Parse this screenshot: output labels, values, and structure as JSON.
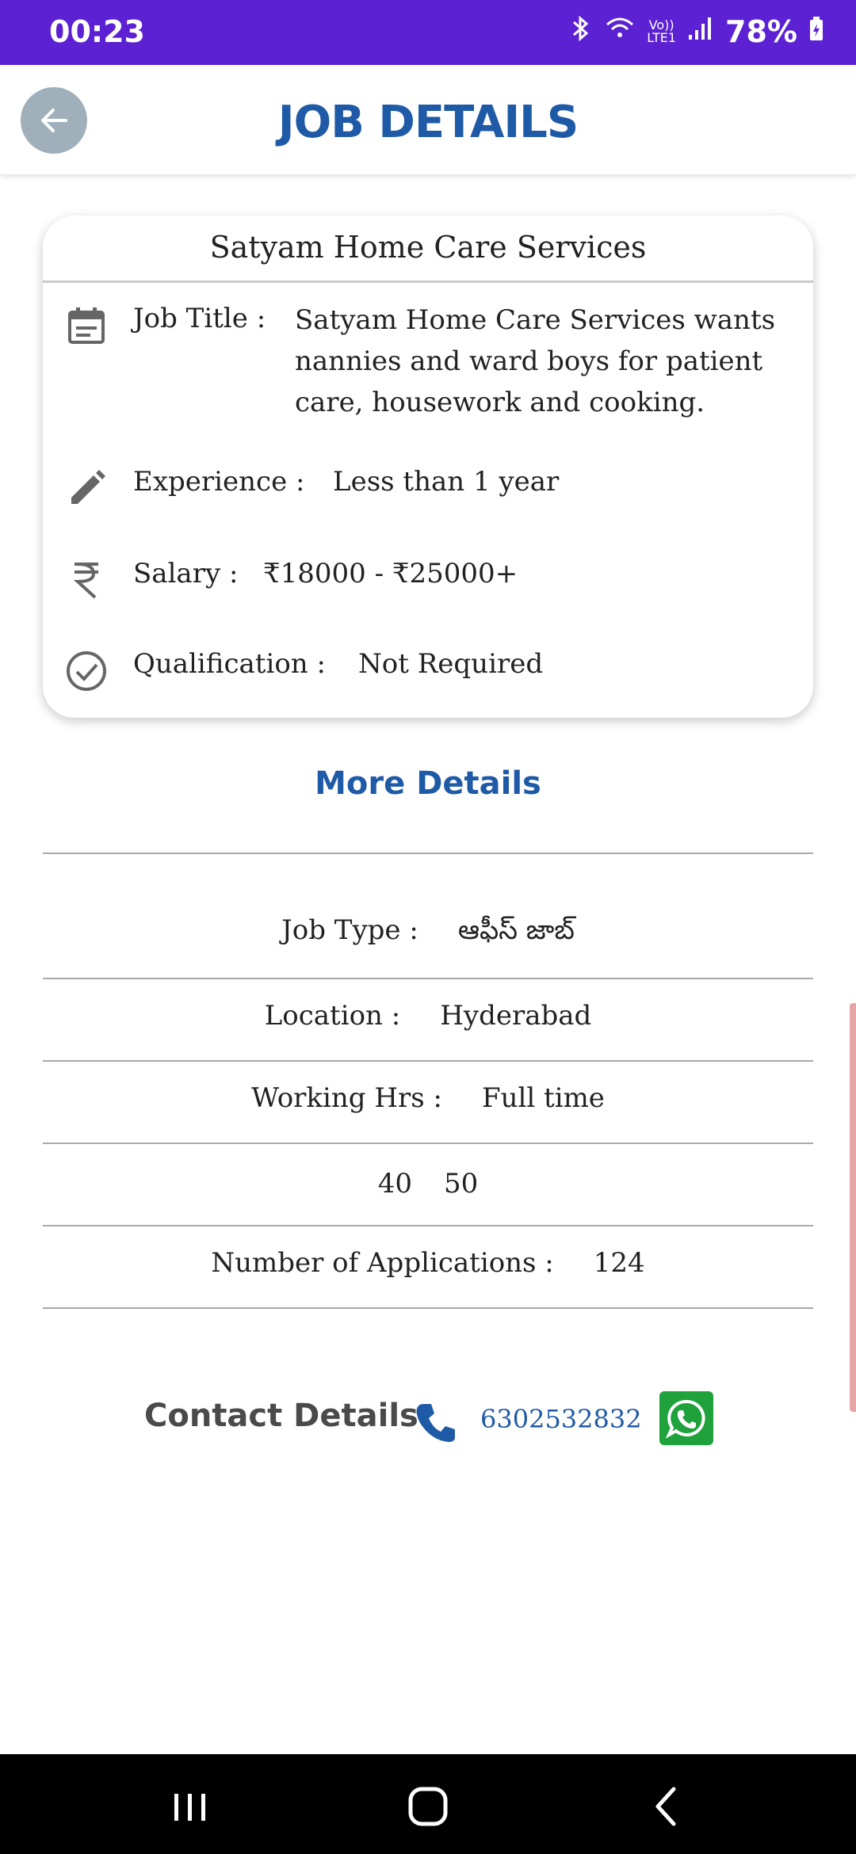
{
  "status_bar": {
    "time": "00:23",
    "network_label_top": "Vo))",
    "network_label_bottom": "LTE1",
    "battery": "78%"
  },
  "app_bar": {
    "title": "JOB DETAILS",
    "back_icon": "arrow-left-icon"
  },
  "job_card": {
    "company": "Satyam Home Care Services",
    "rows": [
      {
        "icon": "calendar-icon",
        "label": "Job Title :",
        "value": "Satyam Home Care Services wants nannies and ward boys for patient care, housework and cooking."
      },
      {
        "icon": "pencil-icon",
        "label": "Experience :",
        "value": "Less than 1 year"
      },
      {
        "icon": "rupee-icon",
        "label": "Salary :",
        "value": "₹18000 - ₹25000+"
      },
      {
        "icon": "check-circle-icon",
        "label": "Qualification :",
        "value": "Not Required"
      }
    ]
  },
  "more_details": {
    "heading": "More Details",
    "rows": [
      {
        "label": "Job Type :",
        "value": "ఆఫీస్ జాబ్"
      },
      {
        "label": "Location :",
        "value": "Hyderabad"
      },
      {
        "label": "Working Hrs :",
        "value": "Full time"
      },
      {
        "label": "40",
        "value": "50"
      },
      {
        "label": "Number of Applications :",
        "value": "124"
      }
    ]
  },
  "contact": {
    "heading": "Contact Details",
    "phone": "6302532832",
    "phone_icon": "phone-icon",
    "whatsapp_icon": "whatsapp-icon"
  },
  "colors": {
    "status_bar": "#5b21d3",
    "accent": "#1f5aa6",
    "whatsapp": "#1fa13c"
  }
}
